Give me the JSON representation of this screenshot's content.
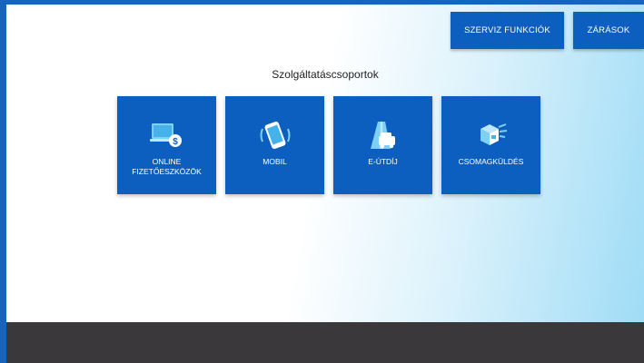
{
  "header": {
    "service_label": "SZERVIZ FUNKCIÓK",
    "closings_label": "ZÁRÁSOK"
  },
  "main": {
    "title": "Szolgáltatáscsoportok",
    "tiles": [
      {
        "label": "ONLINE\nFIZETŐESZKÖZÖK",
        "icon": "online-payment-icon"
      },
      {
        "label": "MOBIL",
        "icon": "mobile-phone-icon"
      },
      {
        "label": "E-ÚTDÍJ",
        "icon": "road-toll-icon"
      },
      {
        "label": "CSOMAGKÜLDÉS",
        "icon": "parcel-icon"
      }
    ]
  },
  "colors": {
    "accent": "#0d5fbf",
    "border": "#1565c0",
    "bottom_bar": "#3b383c"
  }
}
